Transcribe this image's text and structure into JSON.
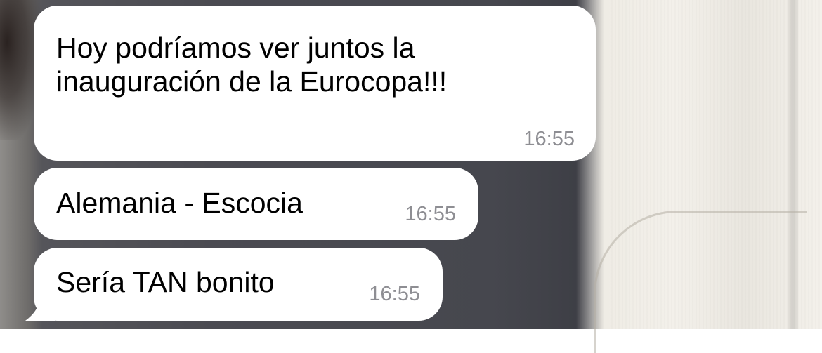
{
  "messages": [
    {
      "lines": [
        "Hoy podríamos ver juntos la",
        "inauguración de la Eurocopa!!!"
      ],
      "time": "16:55"
    },
    {
      "lines": [
        "Alemania - Escocia"
      ],
      "time": "16:55"
    },
    {
      "lines": [
        "Sería TAN bonito"
      ],
      "time": "16:55"
    }
  ],
  "colors": {
    "bubble": "#ffffff",
    "text": "#000000",
    "timestamp": "#8e8e93"
  }
}
